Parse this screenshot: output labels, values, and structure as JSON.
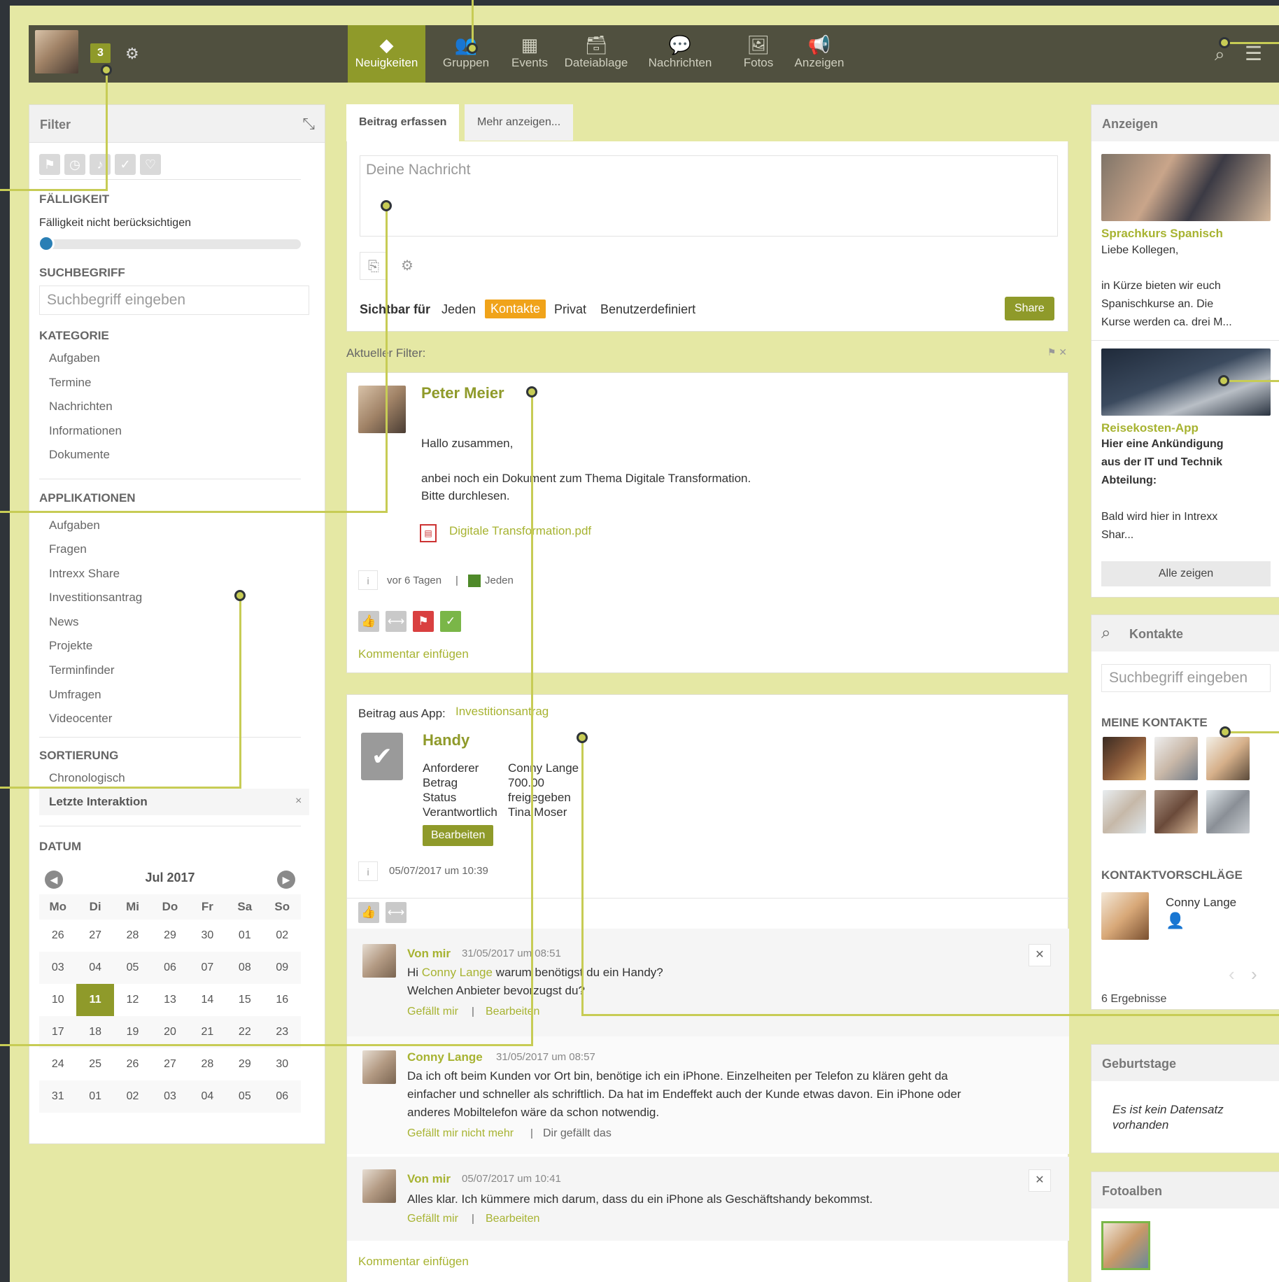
{
  "topbar": {
    "badge_count": "3",
    "nav": [
      {
        "label": "Neuigkeiten",
        "icon": "news-diamond-icon",
        "active": true
      },
      {
        "label": "Gruppen",
        "icon": "groups-icon"
      },
      {
        "label": "Events",
        "icon": "calendar-icon"
      },
      {
        "label": "Dateiablage",
        "icon": "file-archive-icon"
      },
      {
        "label": "Nachrichten",
        "icon": "messages-icon"
      },
      {
        "label": "Fotos",
        "icon": "photos-icon"
      },
      {
        "label": "Anzeigen",
        "icon": "megaphone-icon"
      }
    ]
  },
  "filter": {
    "title": "Filter",
    "faelligkeit_title": "FÄLLIGKEIT",
    "faelligkeit_text": "Fälligkeit nicht berücksichtigen",
    "suchbegriff_title": "SUCHBEGRIFF",
    "suchbegriff_placeholder": "Suchbegriff eingeben",
    "kategorie_title": "KATEGORIE",
    "kategorien": [
      "Aufgaben",
      "Termine",
      "Nachrichten",
      "Informationen",
      "Dokumente"
    ],
    "applikationen_title": "APPLIKATIONEN",
    "applikationen": [
      "Aufgaben",
      "Fragen",
      "Intrexx Share",
      "Investitionsantrag",
      "News",
      "Projekte",
      "Terminfinder",
      "Umfragen",
      "Videocenter"
    ],
    "sortierung_title": "SORTIERUNG",
    "sortierung": [
      "Chronologisch",
      "Letzte Interaktion"
    ],
    "datum_title": "DATUM"
  },
  "calendar": {
    "month": "Jul 2017",
    "weekdays": [
      "Mo",
      "Di",
      "Mi",
      "Do",
      "Fr",
      "Sa",
      "So"
    ],
    "weeks": [
      [
        "26",
        "27",
        "28",
        "29",
        "30",
        "01",
        "02"
      ],
      [
        "03",
        "04",
        "05",
        "06",
        "07",
        "08",
        "09"
      ],
      [
        "10",
        "11",
        "12",
        "13",
        "14",
        "15",
        "16"
      ],
      [
        "17",
        "18",
        "19",
        "20",
        "21",
        "22",
        "23"
      ],
      [
        "24",
        "25",
        "26",
        "27",
        "28",
        "29",
        "30"
      ],
      [
        "31",
        "01",
        "02",
        "03",
        "04",
        "05",
        "06"
      ]
    ],
    "today": "11"
  },
  "composer": {
    "tab_active": "Beitrag erfassen",
    "tab_more": "Mehr anzeigen...",
    "placeholder": "Deine Nachricht",
    "visible_label": "Sichtbar für",
    "vis_options": [
      "Jeden",
      "Kontakte",
      "Privat",
      "Benutzerdefiniert"
    ],
    "vis_selected": "Kontakte",
    "share": "Share"
  },
  "current_filter": "Aktueller Filter:",
  "post1": {
    "author": "Peter Meier",
    "line1": "Hallo zusammen,",
    "line2": "anbei noch ein Dokument zum Thema Digitale Transformation.",
    "line3": "Bitte durchlesen.",
    "attachment": "Digitale Transformation.pdf",
    "time": "vor 6 Tagen",
    "visibility": "Jeden",
    "comment_link": "Kommentar einfügen"
  },
  "post2": {
    "app_prefix": "Beitrag aus App:",
    "app_name": "Investitionsantrag",
    "title": "Handy",
    "fields": [
      {
        "label": "Anforderer",
        "value": "Conny Lange"
      },
      {
        "label": "Betrag",
        "value": "700.00"
      },
      {
        "label": "Status",
        "value": "freigegeben"
      },
      {
        "label": "Verantwortlich",
        "value": "Tina Moser"
      }
    ],
    "edit": "Bearbeiten",
    "time": "05/07/2017 um 10:39",
    "comments": [
      {
        "name": "Von mir",
        "time": "31/05/2017 um 08:51",
        "text_prefix": "Hi",
        "mention": "Conny Lange",
        "text1": "warum benötigst du ein Handy?",
        "text2": "Welchen Anbieter bevorzugst du?",
        "a1": "Gefällt mir",
        "a2": "Bearbeiten"
      },
      {
        "name": "Conny Lange",
        "time": "31/05/2017 um 08:57",
        "line1": "Da ich oft beim Kunden vor Ort bin, benötige ich ein iPhone. Einzelheiten per Telefon zu klären geht da",
        "line2": "einfacher und schneller als schriftlich. Da hat im Endeffekt auch der Kunde etwas davon. Ein iPhone oder",
        "line3": "anderes Mobiltelefon wäre da schon notwendig.",
        "a1": "Gefällt mir nicht mehr",
        "a2": "Dir gefällt das"
      },
      {
        "name": "Von mir",
        "time": "05/07/2017 um 10:41",
        "line1": "Alles klar. Ich kümmere mich darum, dass du ein iPhone als Geschäftshandy bekommst.",
        "a1": "Gefällt mir",
        "a2": "Bearbeiten"
      }
    ],
    "comment_link": "Kommentar einfügen"
  },
  "ads": {
    "title": "Anzeigen",
    "ad1_title": "Sprachkurs Spanisch",
    "ad1_l1": "Liebe Kollegen,",
    "ad1_l2": "in Kürze bieten wir euch",
    "ad1_l3": "Spanischkurse an. Die",
    "ad1_l4": "Kurse werden ca. drei M...",
    "ad2_title": "Reisekosten-App",
    "ad2_b1": "Hier eine Ankündigung",
    "ad2_b2": "aus der IT und Technik",
    "ad2_b3": "Abteilung:",
    "ad2_l1": "Bald wird hier in Intrexx",
    "ad2_l2": "Shar...",
    "show_all": "Alle zeigen"
  },
  "contacts": {
    "title": "Kontakte",
    "placeholder": "Suchbegriff eingeben",
    "mine_title": "MEINE KONTAKTE",
    "suggest_title": "KONTAKTVORSCHLÄGE",
    "suggest_name": "Conny Lange",
    "results": "6 Ergebnisse"
  },
  "birthdays": {
    "title": "Geburtstage",
    "empty_l1": "Es ist kein Datensatz",
    "empty_l2": "vorhanden"
  },
  "photos": {
    "title": "Fotoalben"
  },
  "colors": {
    "accent": "#8f9a2a",
    "link": "#a7b331",
    "topbar": "#50503f",
    "background": "#e5e8a4",
    "orange": "#f0a31a"
  }
}
